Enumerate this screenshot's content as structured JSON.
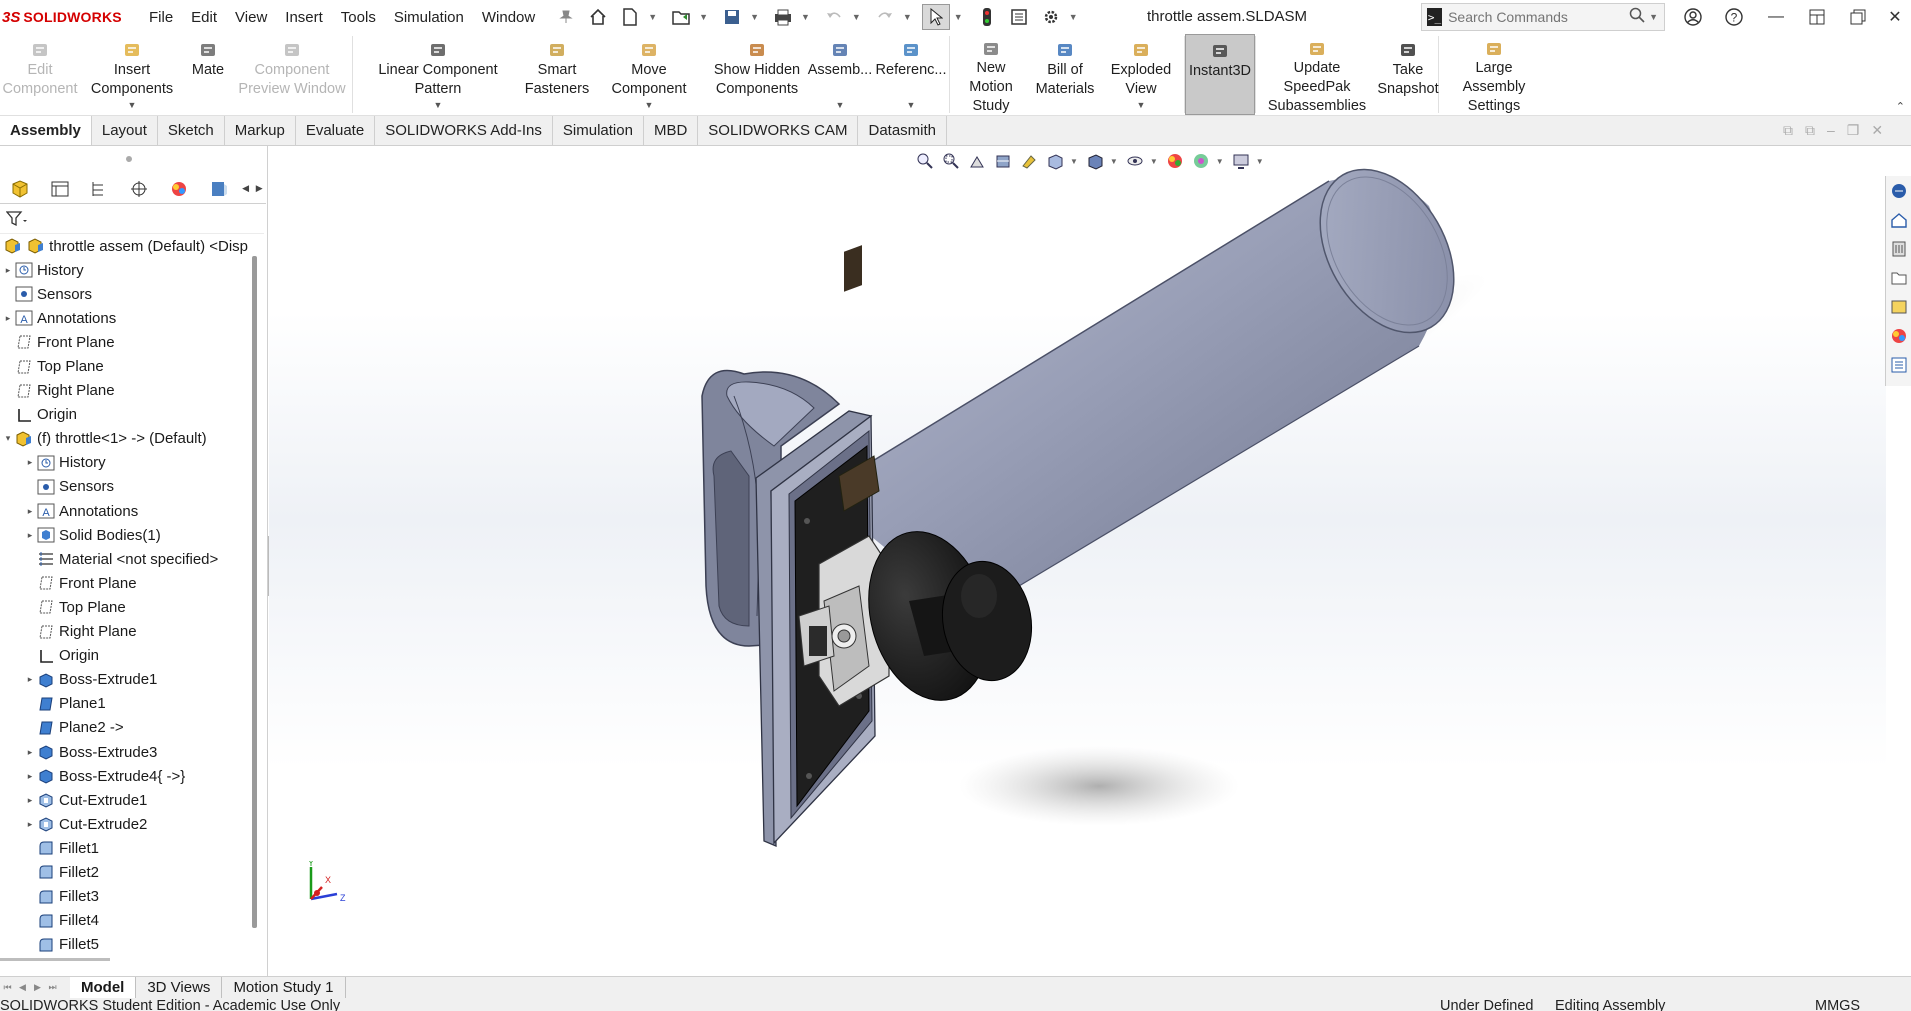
{
  "app": {
    "brand": "SOLIDWORKS",
    "doc_title": "throttle assem.SLDASM"
  },
  "menu": [
    "File",
    "Edit",
    "View",
    "Insert",
    "Tools",
    "Simulation",
    "Window"
  ],
  "search": {
    "placeholder": "Search Commands"
  },
  "commands": [
    {
      "label": "Edit\nComponent",
      "icon": "edit-component-icon",
      "enabled": false,
      "dropdown": false
    },
    {
      "label": "Insert Components",
      "icon": "insert-components-icon",
      "enabled": true,
      "dropdown": true
    },
    {
      "label": "Mate",
      "icon": "mate-icon",
      "enabled": true,
      "dropdown": false
    },
    {
      "label": "Component\nPreview Window",
      "icon": "component-preview-icon",
      "enabled": false,
      "dropdown": false
    },
    {
      "label": "Linear Component Pattern",
      "icon": "linear-pattern-icon",
      "enabled": true,
      "dropdown": true
    },
    {
      "label": "Smart\nFasteners",
      "icon": "smart-fasteners-icon",
      "enabled": true,
      "dropdown": false
    },
    {
      "label": "Move Component",
      "icon": "move-component-icon",
      "enabled": true,
      "dropdown": true
    },
    {
      "label": "Show Hidden\nComponents",
      "icon": "show-hidden-icon",
      "enabled": true,
      "dropdown": false
    },
    {
      "label": "Assemb...",
      "icon": "assembly-features-icon",
      "enabled": true,
      "dropdown": true
    },
    {
      "label": "Referenc...",
      "icon": "reference-geometry-icon",
      "enabled": true,
      "dropdown": true
    },
    {
      "label": "New Motion\nStudy",
      "icon": "motion-study-icon",
      "enabled": true,
      "dropdown": false
    },
    {
      "label": "Bill of\nMaterials",
      "icon": "bom-icon",
      "enabled": true,
      "dropdown": false
    },
    {
      "label": "Exploded View",
      "icon": "exploded-view-icon",
      "enabled": true,
      "dropdown": true
    },
    {
      "label": "Instant3D",
      "icon": "instant3d-icon",
      "enabled": true,
      "dropdown": false,
      "active": true
    },
    {
      "label": "Update SpeedPak\nSubassemblies",
      "icon": "speedpak-icon",
      "enabled": true,
      "dropdown": false
    },
    {
      "label": "Take\nSnapshot",
      "icon": "snapshot-icon",
      "enabled": true,
      "dropdown": false
    },
    {
      "label": "Large Assembly\nSettings",
      "icon": "large-assembly-icon",
      "enabled": true,
      "dropdown": false
    }
  ],
  "tabs": [
    "Assembly",
    "Layout",
    "Sketch",
    "Markup",
    "Evaluate",
    "SOLIDWORKS Add-Ins",
    "Simulation",
    "MBD",
    "SOLIDWORKS CAM",
    "Datasmith"
  ],
  "active_tab": "Assembly",
  "tree": [
    {
      "label": "throttle assem (Default) <Disp",
      "level": 0,
      "icon": "assembly-icon",
      "expand": "none"
    },
    {
      "label": "History",
      "level": 1,
      "icon": "history-icon",
      "expand": "closed"
    },
    {
      "label": "Sensors",
      "level": 1,
      "icon": "sensors-icon",
      "expand": "none"
    },
    {
      "label": "Annotations",
      "level": 1,
      "icon": "annotations-icon",
      "expand": "closed"
    },
    {
      "label": "Front Plane",
      "level": 1,
      "icon": "plane-icon",
      "expand": "none"
    },
    {
      "label": "Top Plane",
      "level": 1,
      "icon": "plane-icon",
      "expand": "none"
    },
    {
      "label": "Right Plane",
      "level": 1,
      "icon": "plane-icon",
      "expand": "none"
    },
    {
      "label": "Origin",
      "level": 1,
      "icon": "origin-icon",
      "expand": "none"
    },
    {
      "label": "(f) throttle<1> -> (Default)",
      "level": 1,
      "icon": "part-icon",
      "expand": "open"
    },
    {
      "label": "History",
      "level": 2,
      "icon": "history-icon",
      "expand": "closed"
    },
    {
      "label": "Sensors",
      "level": 2,
      "icon": "sensors-icon",
      "expand": "none"
    },
    {
      "label": "Annotations",
      "level": 2,
      "icon": "annotations-icon",
      "expand": "closed"
    },
    {
      "label": "Solid Bodies(1)",
      "level": 2,
      "icon": "solid-bodies-icon",
      "expand": "closed"
    },
    {
      "label": "Material <not specified>",
      "level": 2,
      "icon": "material-icon",
      "expand": "none"
    },
    {
      "label": "Front Plane",
      "level": 2,
      "icon": "plane-icon",
      "expand": "none"
    },
    {
      "label": "Top Plane",
      "level": 2,
      "icon": "plane-icon",
      "expand": "none"
    },
    {
      "label": "Right Plane",
      "level": 2,
      "icon": "plane-icon",
      "expand": "none"
    },
    {
      "label": "Origin",
      "level": 2,
      "icon": "origin-icon",
      "expand": "none"
    },
    {
      "label": "Boss-Extrude1",
      "level": 2,
      "icon": "extrude-icon",
      "expand": "closed"
    },
    {
      "label": "Plane1",
      "level": 2,
      "icon": "plane-solid-icon",
      "expand": "none"
    },
    {
      "label": "Plane2 ->",
      "level": 2,
      "icon": "plane-solid-icon",
      "expand": "none"
    },
    {
      "label": "Boss-Extrude3",
      "level": 2,
      "icon": "extrude-icon",
      "expand": "closed"
    },
    {
      "label": "Boss-Extrude4{ ->}",
      "level": 2,
      "icon": "extrude-icon",
      "expand": "closed"
    },
    {
      "label": "Cut-Extrude1",
      "level": 2,
      "icon": "cut-extrude-icon",
      "expand": "closed"
    },
    {
      "label": "Cut-Extrude2",
      "level": 2,
      "icon": "cut-extrude-icon",
      "expand": "closed"
    },
    {
      "label": "Fillet1",
      "level": 2,
      "icon": "fillet-icon",
      "expand": "none"
    },
    {
      "label": "Fillet2",
      "level": 2,
      "icon": "fillet-icon",
      "expand": "none"
    },
    {
      "label": "Fillet3",
      "level": 2,
      "icon": "fillet-icon",
      "expand": "none"
    },
    {
      "label": "Fillet4",
      "level": 2,
      "icon": "fillet-icon",
      "expand": "none"
    },
    {
      "label": "Fillet5",
      "level": 2,
      "icon": "fillet-icon",
      "expand": "none"
    }
  ],
  "triad": {
    "x": "X",
    "y": "Y",
    "z": "Z"
  },
  "bottom_tabs": [
    "Model",
    "3D Views",
    "Motion Study 1"
  ],
  "active_bottom_tab": "Model",
  "status": {
    "left": "SOLIDWORKS Student Edition - Academic Use Only",
    "defined": "Under Defined",
    "mode": "Editing Assembly",
    "units": "MMGS"
  },
  "colors": {
    "brand_red": "#d40000",
    "model_gray": "#8d92a6",
    "joystick_black": "#1c1c1c"
  }
}
